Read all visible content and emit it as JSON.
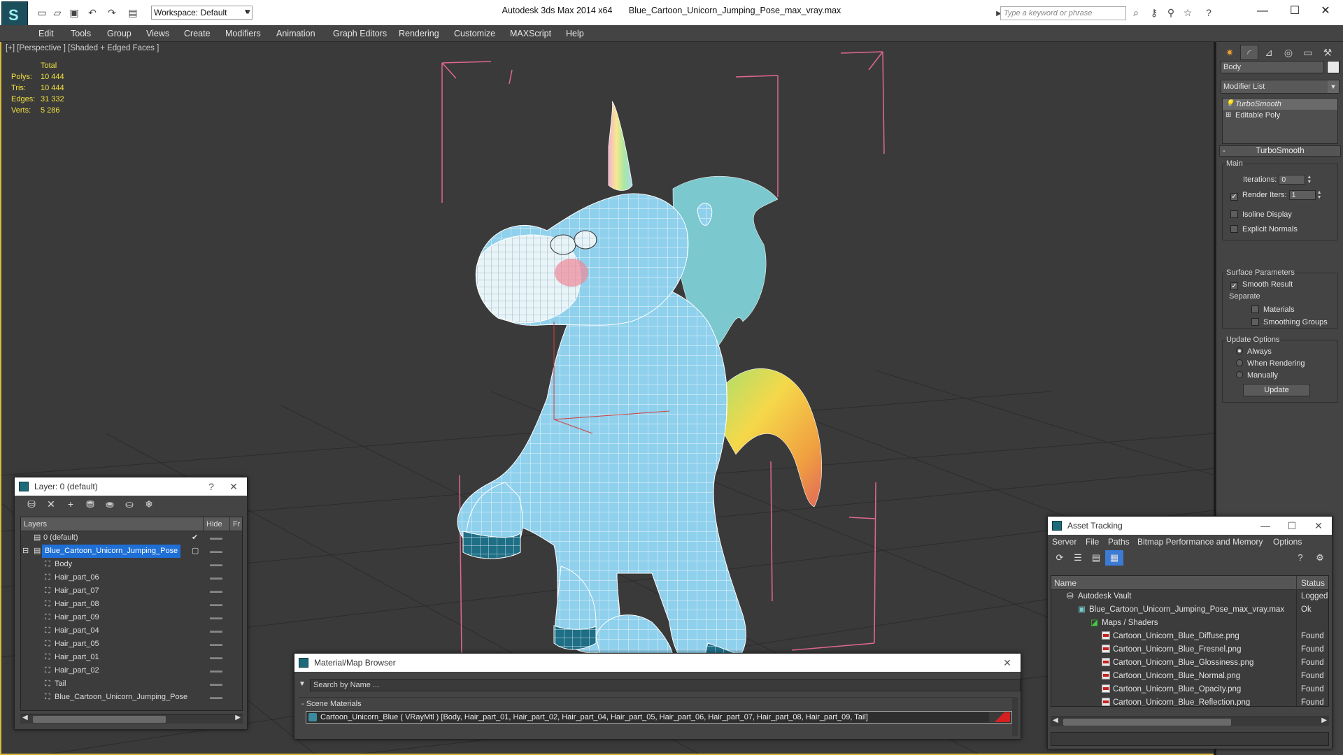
{
  "window": {
    "app_name": "Autodesk 3ds Max  2014 x64",
    "file_name": "Blue_Cartoon_Unicorn_Jumping_Pose_max_vray.max",
    "workspace": "Workspace: Default",
    "search_placeholder": "Type a keyword or phrase"
  },
  "menu": [
    "Edit",
    "Tools",
    "Group",
    "Views",
    "Create",
    "Modifiers",
    "Animation",
    "Graph Editors",
    "Rendering",
    "Customize",
    "MAXScript",
    "Help"
  ],
  "viewport": {
    "label": "[+] [Perspective ] [Shaded + Edged Faces ]",
    "stats": {
      "header": "Total",
      "polys_label": "Polys:",
      "polys": "10 444",
      "tris_label": "Tris:",
      "tris": "10 444",
      "edges_label": "Edges:",
      "edges": "31 332",
      "verts_label": "Verts:",
      "verts": "5 286"
    },
    "colors": {
      "bg": "#3a3a3a",
      "wire": "#ffffff",
      "body": "#8fd0ec",
      "hooves": "#1e6f86",
      "bbox": "#e06890"
    }
  },
  "command_panel": {
    "object_name": "Body",
    "modifier_list": "Modifier List",
    "stack": [
      "TurboSmooth",
      "Editable Poly"
    ],
    "rollout_title": "TurboSmooth",
    "main_label": "Main",
    "iterations_label": "Iterations:",
    "iterations": "0",
    "render_iters_label": "Render Iters:",
    "render_iters": "1",
    "isoline": "Isoline Display",
    "explicit_normals": "Explicit Normals",
    "surface_params": "Surface Parameters",
    "smooth_result": "Smooth Result",
    "separate": "Separate",
    "materials": "Materials",
    "smoothing_groups": "Smoothing Groups",
    "update_options": "Update Options",
    "always": "Always",
    "when_rendering": "When Rendering",
    "manually": "Manually",
    "update_btn": "Update"
  },
  "layer_window": {
    "title": "Layer: 0 (default)",
    "help": "?",
    "col_layers": "Layers",
    "col_hide": "Hide",
    "col_fr": "Fr",
    "rows": [
      {
        "name": "0 (default)",
        "indent": 0
      },
      {
        "name": "Blue_Cartoon_Unicorn_Jumping_Pose",
        "indent": 0
      },
      {
        "name": "Body",
        "indent": 1
      },
      {
        "name": "Hair_part_06",
        "indent": 1
      },
      {
        "name": "Hair_part_07",
        "indent": 1
      },
      {
        "name": "Hair_part_08",
        "indent": 1
      },
      {
        "name": "Hair_part_09",
        "indent": 1
      },
      {
        "name": "Hair_part_04",
        "indent": 1
      },
      {
        "name": "Hair_part_05",
        "indent": 1
      },
      {
        "name": "Hair_part_01",
        "indent": 1
      },
      {
        "name": "Hair_part_02",
        "indent": 1
      },
      {
        "name": "Tail",
        "indent": 1
      },
      {
        "name": "Blue_Cartoon_Unicorn_Jumping_Pose",
        "indent": 1
      }
    ]
  },
  "material_browser": {
    "title": "Material/Map Browser",
    "search": "Search by Name ...",
    "group": "- Scene Materials",
    "material": "Cartoon_Unicorn_Blue  ( VRayMtl )  [Body, Hair_part_01, Hair_part_02, Hair_part_04, Hair_part_05, Hair_part_06, Hair_part_07, Hair_part_08, Hair_part_09, Tail]"
  },
  "asset_tracking": {
    "title": "Asset Tracking",
    "menu": [
      "Server",
      "File",
      "Paths",
      "Bitmap Performance and Memory",
      "Options"
    ],
    "col_name": "Name",
    "col_status": "Status",
    "rows": [
      {
        "name": "Autodesk Vault",
        "status": "Logged Out",
        "indent": 1,
        "kind": "vault"
      },
      {
        "name": "Blue_Cartoon_Unicorn_Jumping_Pose_max_vray.max",
        "status": "Ok",
        "indent": 2,
        "kind": "max"
      },
      {
        "name": "Maps / Shaders",
        "status": "",
        "indent": 3,
        "kind": "folder"
      },
      {
        "name": "Cartoon_Unicorn_Blue_Diffuse.png",
        "status": "Found",
        "indent": 4,
        "kind": "png"
      },
      {
        "name": "Cartoon_Unicorn_Blue_Fresnel.png",
        "status": "Found",
        "indent": 4,
        "kind": "png"
      },
      {
        "name": "Cartoon_Unicorn_Blue_Glossiness.png",
        "status": "Found",
        "indent": 4,
        "kind": "png"
      },
      {
        "name": "Cartoon_Unicorn_Blue_Normal.png",
        "status": "Found",
        "indent": 4,
        "kind": "png"
      },
      {
        "name": "Cartoon_Unicorn_Blue_Opacity.png",
        "status": "Found",
        "indent": 4,
        "kind": "png"
      },
      {
        "name": "Cartoon_Unicorn_Blue_Reflection.png",
        "status": "Found",
        "indent": 4,
        "kind": "png"
      }
    ]
  }
}
